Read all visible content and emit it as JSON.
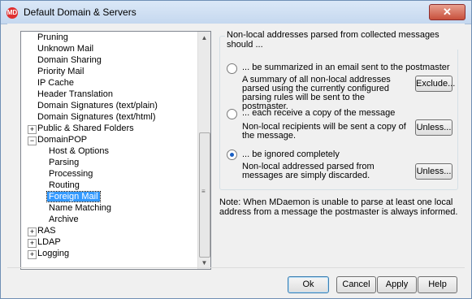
{
  "window": {
    "title": "Default Domain & Servers",
    "app_icon_text": "MD",
    "close_symbol": "✕"
  },
  "tree": {
    "items": [
      {
        "label": "Pruning"
      },
      {
        "label": "Unknown Mail"
      },
      {
        "label": "Domain Sharing"
      },
      {
        "label": "Priority Mail"
      },
      {
        "label": "IP Cache"
      },
      {
        "label": "Header Translation"
      },
      {
        "label": "Domain Signatures (text/plain)"
      },
      {
        "label": "Domain Signatures (text/html)"
      },
      {
        "label": "Public & Shared Folders",
        "expander": "+"
      },
      {
        "label": "DomainPOP",
        "expander": "−"
      },
      {
        "label": "Host & Options"
      },
      {
        "label": "Parsing"
      },
      {
        "label": "Processing"
      },
      {
        "label": "Routing"
      },
      {
        "label": "Foreign Mail",
        "selected": true
      },
      {
        "label": "Name Matching"
      },
      {
        "label": "Archive"
      },
      {
        "label": "RAS",
        "expander": "+"
      },
      {
        "label": "LDAP",
        "expander": "+"
      },
      {
        "label": "Logging",
        "expander": "+"
      }
    ],
    "scrollbar": {
      "up": "▲",
      "grip": "≡",
      "down": "▼"
    }
  },
  "panel": {
    "group_label": "Non-local addresses parsed from collected messages should ...",
    "options": [
      {
        "label": "... be summarized in an email sent to the postmaster",
        "checked": false,
        "description": "A summary of all non-local addresses parsed using the currently configured parsing rules will be sent to the postmaster.",
        "button": "Exclude..."
      },
      {
        "label": "... each receive a copy of the message",
        "checked": false,
        "description": "Non-local recipients will be sent a copy of the message.",
        "button": "Unless..."
      },
      {
        "label": "... be ignored completely",
        "checked": true,
        "description": "Non-local addressed parsed from messages are simply discarded.",
        "button": "Unless..."
      }
    ],
    "note": "Note:  When MDaemon is unable to parse at least one local address from a message the postmaster is always informed."
  },
  "footer": {
    "ok": "Ok",
    "cancel": "Cancel",
    "apply": "Apply",
    "help": "Help"
  }
}
